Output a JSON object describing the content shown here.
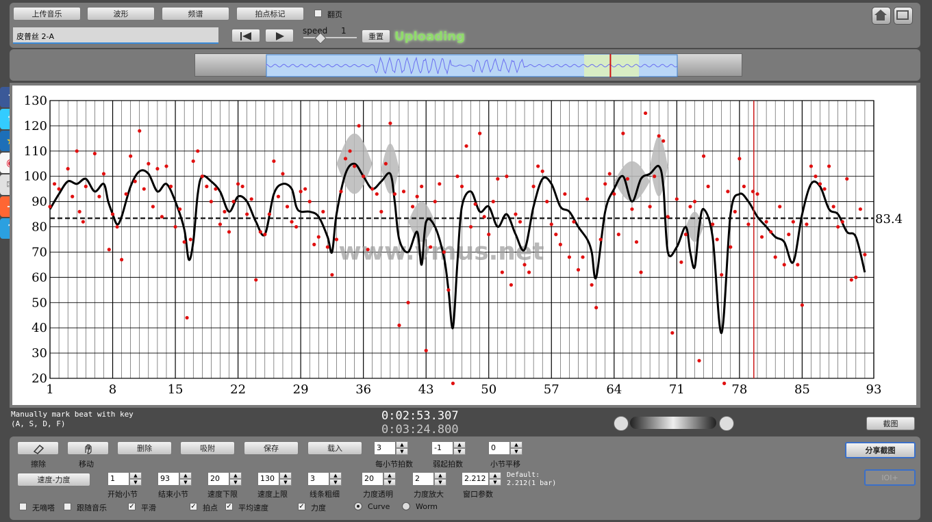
{
  "toolbar": {
    "upload": "上传音乐",
    "waveform": "波形",
    "spectrum": "频谱",
    "beat_mark": "拍点标记",
    "flip": "翻页"
  },
  "track": {
    "name": "皮普丝 2-A"
  },
  "speed": {
    "label": "speed",
    "value": "1",
    "reset": "重置",
    "status": "Uploading"
  },
  "overview": {
    "selection_start": 0.13,
    "selection_end": 0.88,
    "highlight_start": 0.71,
    "highlight_end": 0.81,
    "playhead": 0.758
  },
  "chart_data": {
    "type": "line",
    "ylim": [
      20,
      130
    ],
    "yticks": [
      20,
      30,
      40,
      50,
      60,
      70,
      80,
      90,
      100,
      110,
      120,
      130
    ],
    "xlim": [
      1,
      93
    ],
    "xticks": [
      1,
      8,
      15,
      22,
      29,
      36,
      43,
      50,
      57,
      64,
      71,
      78,
      85,
      93
    ],
    "average": 83.4,
    "average_label": "83.4",
    "current_bar": 79.6,
    "watermark": "www.vmus.net",
    "curve": [
      [
        1,
        87
      ],
      [
        2,
        93
      ],
      [
        3,
        98
      ],
      [
        4,
        97
      ],
      [
        5,
        99
      ],
      [
        6,
        94
      ],
      [
        7,
        97
      ],
      [
        7.5,
        90
      ],
      [
        8,
        85
      ],
      [
        8.5,
        81
      ],
      [
        9,
        84
      ],
      [
        10,
        96
      ],
      [
        11,
        102
      ],
      [
        12,
        101
      ],
      [
        13,
        94
      ],
      [
        14,
        97
      ],
      [
        15,
        90
      ],
      [
        16,
        79
      ],
      [
        16.5,
        67
      ],
      [
        17,
        74
      ],
      [
        17.5,
        93
      ],
      [
        18,
        100
      ],
      [
        19,
        98
      ],
      [
        20,
        94
      ],
      [
        21,
        86
      ],
      [
        22,
        92
      ],
      [
        23,
        90
      ],
      [
        24,
        82
      ],
      [
        25,
        77
      ],
      [
        26,
        93
      ],
      [
        27,
        97
      ],
      [
        28,
        95
      ],
      [
        28.5,
        88
      ],
      [
        29,
        86
      ],
      [
        30,
        86
      ],
      [
        31,
        84
      ],
      [
        32,
        76
      ],
      [
        32.5,
        70
      ],
      [
        33,
        85
      ],
      [
        34,
        101
      ],
      [
        35,
        105
      ],
      [
        36,
        100
      ],
      [
        37,
        95
      ],
      [
        38,
        98
      ],
      [
        39,
        101
      ],
      [
        39.5,
        90
      ],
      [
        40,
        75
      ],
      [
        41,
        70
      ],
      [
        42,
        78
      ],
      [
        42.5,
        65
      ],
      [
        43,
        82
      ],
      [
        44,
        80
      ],
      [
        45,
        68
      ],
      [
        45.5,
        55
      ],
      [
        46,
        40
      ],
      [
        46.5,
        66
      ],
      [
        47,
        88
      ],
      [
        48,
        94
      ],
      [
        49,
        86
      ],
      [
        50,
        88
      ],
      [
        51,
        80
      ],
      [
        52,
        85
      ],
      [
        53,
        77
      ],
      [
        54,
        71
      ],
      [
        55,
        88
      ],
      [
        56,
        99
      ],
      [
        57,
        97
      ],
      [
        58,
        88
      ],
      [
        59,
        86
      ],
      [
        60,
        80
      ],
      [
        61,
        75
      ],
      [
        61.5,
        70
      ],
      [
        62,
        60
      ],
      [
        63,
        86
      ],
      [
        64,
        95
      ],
      [
        65,
        100
      ],
      [
        66,
        90
      ],
      [
        67,
        99
      ],
      [
        68,
        101
      ],
      [
        69,
        104
      ],
      [
        69.5,
        96
      ],
      [
        70,
        70
      ],
      [
        71,
        72
      ],
      [
        72,
        80
      ],
      [
        72.5,
        70
      ],
      [
        73,
        64
      ],
      [
        73.5,
        80
      ],
      [
        74,
        87
      ],
      [
        75,
        76
      ],
      [
        76,
        38
      ],
      [
        77,
        85
      ],
      [
        78,
        93
      ],
      [
        79,
        90
      ],
      [
        80,
        84
      ],
      [
        81,
        80
      ],
      [
        82,
        76
      ],
      [
        83,
        74
      ],
      [
        84,
        66
      ],
      [
        85,
        85
      ],
      [
        86,
        97
      ],
      [
        87,
        96
      ],
      [
        88,
        87
      ],
      [
        89,
        85
      ],
      [
        90,
        78
      ],
      [
        91,
        76
      ],
      [
        92,
        62
      ]
    ],
    "dots": [
      [
        1,
        88
      ],
      [
        1.5,
        97
      ],
      [
        2,
        95
      ],
      [
        3,
        103
      ],
      [
        3.5,
        92
      ],
      [
        4,
        110
      ],
      [
        4.3,
        86
      ],
      [
        4.7,
        82
      ],
      [
        5,
        96
      ],
      [
        6,
        109
      ],
      [
        6.5,
        92
      ],
      [
        7,
        101
      ],
      [
        7.6,
        71
      ],
      [
        8,
        85
      ],
      [
        8.5,
        80
      ],
      [
        9,
        67
      ],
      [
        9.5,
        93
      ],
      [
        10,
        108
      ],
      [
        10.5,
        98
      ],
      [
        11,
        118
      ],
      [
        11.5,
        95
      ],
      [
        12,
        105
      ],
      [
        12.5,
        88
      ],
      [
        13,
        103
      ],
      [
        13.5,
        84
      ],
      [
        14,
        104
      ],
      [
        14.5,
        96
      ],
      [
        15,
        80
      ],
      [
        15.5,
        87
      ],
      [
        16,
        74
      ],
      [
        16.3,
        44
      ],
      [
        16.7,
        75
      ],
      [
        17,
        106
      ],
      [
        17.5,
        110
      ],
      [
        18,
        100
      ],
      [
        18.5,
        96
      ],
      [
        19,
        90
      ],
      [
        19.5,
        95
      ],
      [
        20,
        81
      ],
      [
        20.5,
        86
      ],
      [
        21,
        78
      ],
      [
        21.5,
        90
      ],
      [
        22,
        97
      ],
      [
        22.5,
        96
      ],
      [
        23,
        85
      ],
      [
        23.5,
        91
      ],
      [
        24,
        59
      ],
      [
        24.5,
        78
      ],
      [
        25,
        77
      ],
      [
        25.5,
        85
      ],
      [
        26,
        106
      ],
      [
        26.5,
        92
      ],
      [
        27,
        101
      ],
      [
        27.5,
        88
      ],
      [
        28,
        82
      ],
      [
        28.5,
        80
      ],
      [
        29,
        94
      ],
      [
        29.5,
        95
      ],
      [
        30,
        90
      ],
      [
        30.5,
        73
      ],
      [
        31,
        76
      ],
      [
        31.5,
        86
      ],
      [
        32,
        72
      ],
      [
        32.5,
        61
      ],
      [
        33,
        75
      ],
      [
        33.5,
        94
      ],
      [
        34,
        107
      ],
      [
        34.5,
        110
      ],
      [
        35,
        104
      ],
      [
        35.5,
        120
      ],
      [
        36,
        100
      ],
      [
        36.5,
        71
      ],
      [
        37,
        95
      ],
      [
        37.5,
        93
      ],
      [
        38,
        86
      ],
      [
        38.5,
        105
      ],
      [
        39,
        121
      ],
      [
        39.5,
        93
      ],
      [
        40,
        41
      ],
      [
        40.5,
        94
      ],
      [
        41,
        50
      ],
      [
        41.5,
        88
      ],
      [
        42,
        92
      ],
      [
        42.5,
        96
      ],
      [
        43,
        31
      ],
      [
        43.5,
        72
      ],
      [
        44,
        90
      ],
      [
        44.5,
        97
      ],
      [
        45,
        70
      ],
      [
        45.5,
        55
      ],
      [
        46,
        18
      ],
      [
        46.5,
        100
      ],
      [
        47,
        96
      ],
      [
        47.5,
        112
      ],
      [
        48,
        80
      ],
      [
        48.5,
        89
      ],
      [
        49,
        117
      ],
      [
        49.5,
        84
      ],
      [
        50,
        77
      ],
      [
        50.5,
        90
      ],
      [
        51,
        99
      ],
      [
        51.5,
        62
      ],
      [
        52,
        100
      ],
      [
        52.5,
        57
      ],
      [
        53,
        85
      ],
      [
        53.5,
        82
      ],
      [
        54,
        65
      ],
      [
        54.5,
        62
      ],
      [
        55,
        96
      ],
      [
        55.5,
        104
      ],
      [
        56,
        102
      ],
      [
        56.5,
        90
      ],
      [
        57,
        81
      ],
      [
        57.5,
        77
      ],
      [
        58,
        73
      ],
      [
        58.5,
        93
      ],
      [
        59,
        68
      ],
      [
        59.5,
        82
      ],
      [
        60,
        63
      ],
      [
        60.5,
        68
      ],
      [
        61,
        91
      ],
      [
        61.5,
        57
      ],
      [
        62,
        48
      ],
      [
        62.5,
        75
      ],
      [
        63,
        97
      ],
      [
        63.5,
        101
      ],
      [
        64,
        93
      ],
      [
        64.5,
        77
      ],
      [
        65,
        117
      ],
      [
        65.5,
        99
      ],
      [
        66,
        87
      ],
      [
        66.5,
        74
      ],
      [
        67,
        62
      ],
      [
        67.5,
        125
      ],
      [
        68,
        88
      ],
      [
        68.5,
        100
      ],
      [
        69,
        116
      ],
      [
        69.5,
        114
      ],
      [
        70,
        84
      ],
      [
        70.5,
        38
      ],
      [
        71,
        91
      ],
      [
        71.5,
        66
      ],
      [
        72,
        77
      ],
      [
        72.5,
        88
      ],
      [
        73,
        90
      ],
      [
        73.5,
        27
      ],
      [
        74,
        108
      ],
      [
        74.5,
        96
      ],
      [
        75,
        81
      ],
      [
        75.5,
        75
      ],
      [
        76,
        61
      ],
      [
        76.3,
        18
      ],
      [
        76.7,
        94
      ],
      [
        77,
        72
      ],
      [
        77.5,
        86
      ],
      [
        78,
        107
      ],
      [
        78.5,
        96
      ],
      [
        79,
        81
      ],
      [
        79.5,
        94
      ],
      [
        80,
        93
      ],
      [
        80.5,
        76
      ],
      [
        81,
        82
      ],
      [
        81.5,
        78
      ],
      [
        82,
        68
      ],
      [
        82.5,
        88
      ],
      [
        83,
        65
      ],
      [
        83.5,
        77
      ],
      [
        84,
        82
      ],
      [
        84.5,
        65
      ],
      [
        85,
        49
      ],
      [
        85.5,
        81
      ],
      [
        86,
        104
      ],
      [
        86.5,
        100
      ],
      [
        87,
        97
      ],
      [
        87.5,
        95
      ],
      [
        88,
        104
      ],
      [
        88.5,
        88
      ],
      [
        89,
        80
      ],
      [
        89.5,
        82
      ],
      [
        90,
        99
      ],
      [
        90.5,
        59
      ],
      [
        91,
        60
      ],
      [
        91.5,
        87
      ],
      [
        92,
        69
      ]
    ],
    "bands": [
      [
        33,
        37,
        105,
        12
      ],
      [
        38,
        40,
        103,
        10
      ],
      [
        41,
        44,
        82,
        8
      ],
      [
        64,
        68,
        98,
        8
      ],
      [
        68,
        70,
        104,
        12
      ],
      [
        72,
        74,
        80,
        6
      ]
    ]
  },
  "hint": {
    "line1": "Manually mark beat with key",
    "line2": "(A, S, D, F)"
  },
  "time": {
    "current": "0:02:53.307",
    "total": "0:03:24.800"
  },
  "buttons": {
    "capture": "截图",
    "share": "分享截图",
    "eraser": "擦除",
    "eraser_label": "擦除",
    "move": "移动",
    "delete": "删除",
    "snap": "吸附",
    "save": "保存",
    "load": "载入",
    "tempo_dyn": "速度-力度",
    "ioi": "IOI+"
  },
  "params": {
    "beats_per_bar": {
      "value": "3",
      "label": "每小节拍数"
    },
    "pickup": {
      "value": "-1",
      "label": "弱起拍数"
    },
    "bar_shift": {
      "value": "0",
      "label": "小节平移"
    },
    "start_bar": {
      "value": "1",
      "label": "开始小节"
    },
    "end_bar": {
      "value": "93",
      "label": "结束小节"
    },
    "tempo_low": {
      "value": "20",
      "label": "速度下限"
    },
    "tempo_high": {
      "value": "130",
      "label": "速度上限"
    },
    "line_width": {
      "value": "3",
      "label": "线条粗细"
    },
    "force_alpha": {
      "value": "20",
      "label": "力度透明"
    },
    "force_zoom": {
      "value": "2",
      "label": "力度放大"
    },
    "window": {
      "value": "2.212",
      "label": "窗口参数"
    },
    "default_line1": "Default:",
    "default_line2": "2.212(1 bar)"
  },
  "options": {
    "no_beep": "无嘀嗒",
    "follow_music": "跟随音乐",
    "smooth": "平滑",
    "beat_point": "拍点",
    "avg_tempo": "平均速度",
    "dynamics": "力度",
    "curve": "Curve",
    "worm": "Worm"
  },
  "colors": {
    "accent_green": "#8fdc6a",
    "dot": "#e01010",
    "curve": "#000000",
    "band": "#b8b8b8",
    "avg_line": "#222222",
    "playhead": "#cc1818"
  }
}
